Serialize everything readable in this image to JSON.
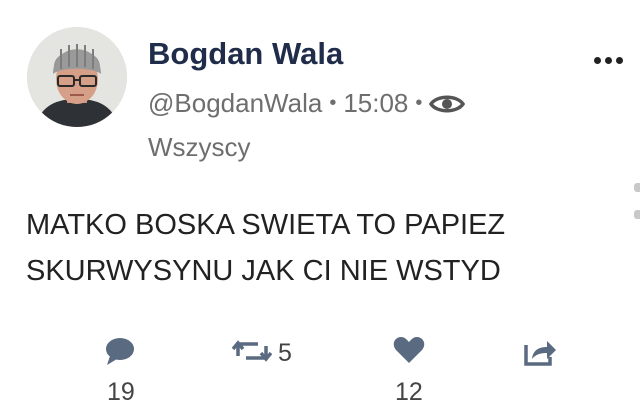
{
  "post": {
    "author": {
      "display_name": "Bogdan Wala",
      "handle": "@BogdanWala"
    },
    "separator": "•",
    "time": "15:08",
    "visibility_icon": "eye-icon",
    "visibility_label": "Wszyscy",
    "text_lines": [
      "MATKO BOSKA SWIETA TO PAPIEZ",
      "SKURWYSYNU JAK CI NIE WSTYD"
    ],
    "actions": {
      "reply": {
        "icon": "comment-icon",
        "count": "19"
      },
      "repost": {
        "icon": "repost-icon",
        "count": "5"
      },
      "like": {
        "icon": "heart-icon",
        "count": "12"
      },
      "share": {
        "icon": "share-icon"
      }
    },
    "more_icon": "more-dots-icon"
  },
  "colors": {
    "name": "#1f2d4a",
    "meta": "#6e6e6e",
    "text": "#222222",
    "icon": "#5a6a80"
  }
}
